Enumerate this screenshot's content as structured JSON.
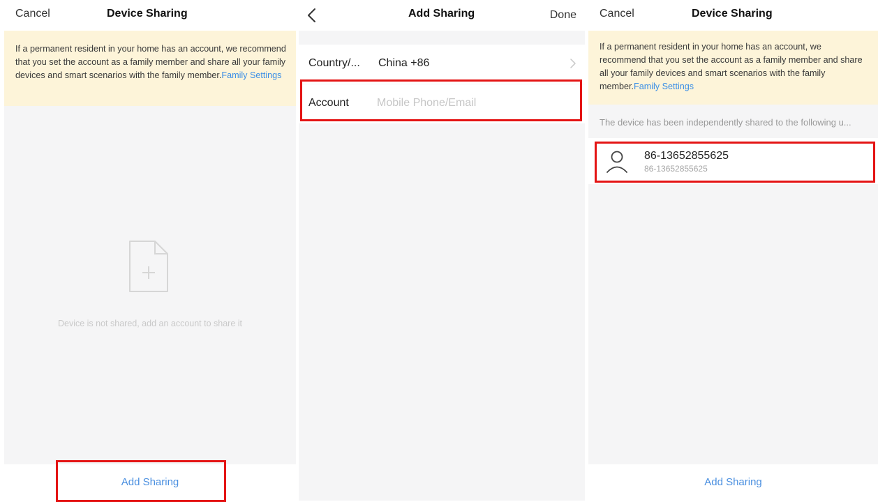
{
  "screens": {
    "empty": {
      "nav": {
        "left": "Cancel",
        "title": "Device Sharing"
      },
      "notice": {
        "text": "If a permanent resident in your home has an account, we recommend that you set the account as a family member and share all your family devices and smart scenarios with the family member.",
        "link": "Family Settings"
      },
      "empty_state": {
        "icon": "file-add-icon",
        "message": "Device is not shared, add an account to share it"
      },
      "bottom_button": "Add Sharing"
    },
    "add": {
      "nav": {
        "back_icon": "chevron-left-icon",
        "title": "Add Sharing",
        "right": "Done"
      },
      "country": {
        "label": "Country/...",
        "value": "China +86",
        "icon": "chevron-right-icon"
      },
      "account": {
        "label": "Account",
        "placeholder": "Mobile Phone/Email",
        "value": ""
      }
    },
    "shared": {
      "nav": {
        "left": "Cancel",
        "title": "Device Sharing"
      },
      "notice": {
        "text": "If a permanent resident in your home has an account, we recommend that you set the account as a family member and share all your family devices and smart scenarios with the family member.",
        "link": "Family Settings"
      },
      "list_caption": "The device has been independently shared to the following u...",
      "users": [
        {
          "name": "86-13652855625",
          "sub": "86-13652855625",
          "icon": "user-icon"
        }
      ],
      "bottom_button": "Add Sharing"
    }
  },
  "colors": {
    "accent": "#4a8fe0",
    "link": "#3a8ee6",
    "notice_bg": "#fdf4d9",
    "highlight": "#e41414"
  }
}
